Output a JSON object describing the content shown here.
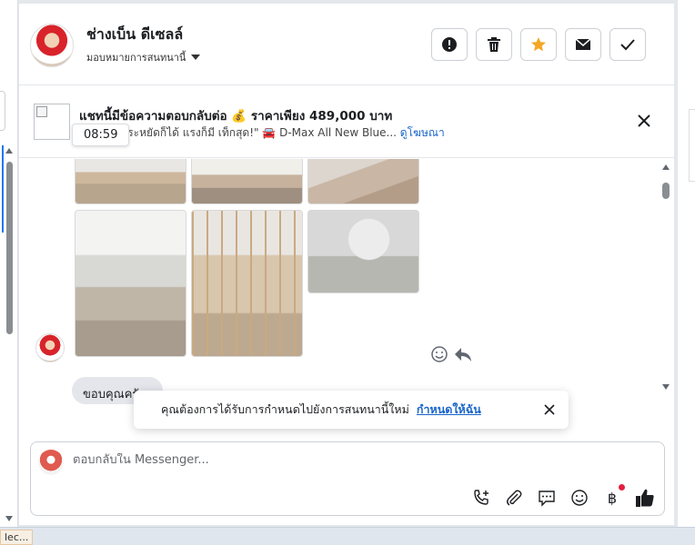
{
  "header": {
    "name": "ช่างเบ็น ดีเซลล์",
    "assign_label": "มอบหมายการสนทนานี้"
  },
  "ad": {
    "title": "แชทนี้มีข้อความตอบกลับต่อ 💰 ราคาเพียง 489,000 บาท",
    "subtitle_text": "\"Power ประหยัดก็ได้ แรงก็มี เท็กสุด!\" 🚘 D-Max All New Blue...",
    "subtitle_link": "ดูโฆษณา",
    "timestamp": "08:59"
  },
  "chat": {
    "bubble_text": "ขอบคุณครับ"
  },
  "toast": {
    "message": "คุณต้องการได้รับการกำหนดไปยังการสนทนานี้ใหม่",
    "cta": "กำหนดให้ฉัน"
  },
  "composer": {
    "placeholder": "ตอบกลับใน Messenger...",
    "currency_symbol": "฿"
  },
  "taskbar": {
    "chip": "lec..."
  },
  "colors": {
    "accent": "#1a66c9",
    "star": "#f5a623",
    "notification": "#e41e3f"
  }
}
